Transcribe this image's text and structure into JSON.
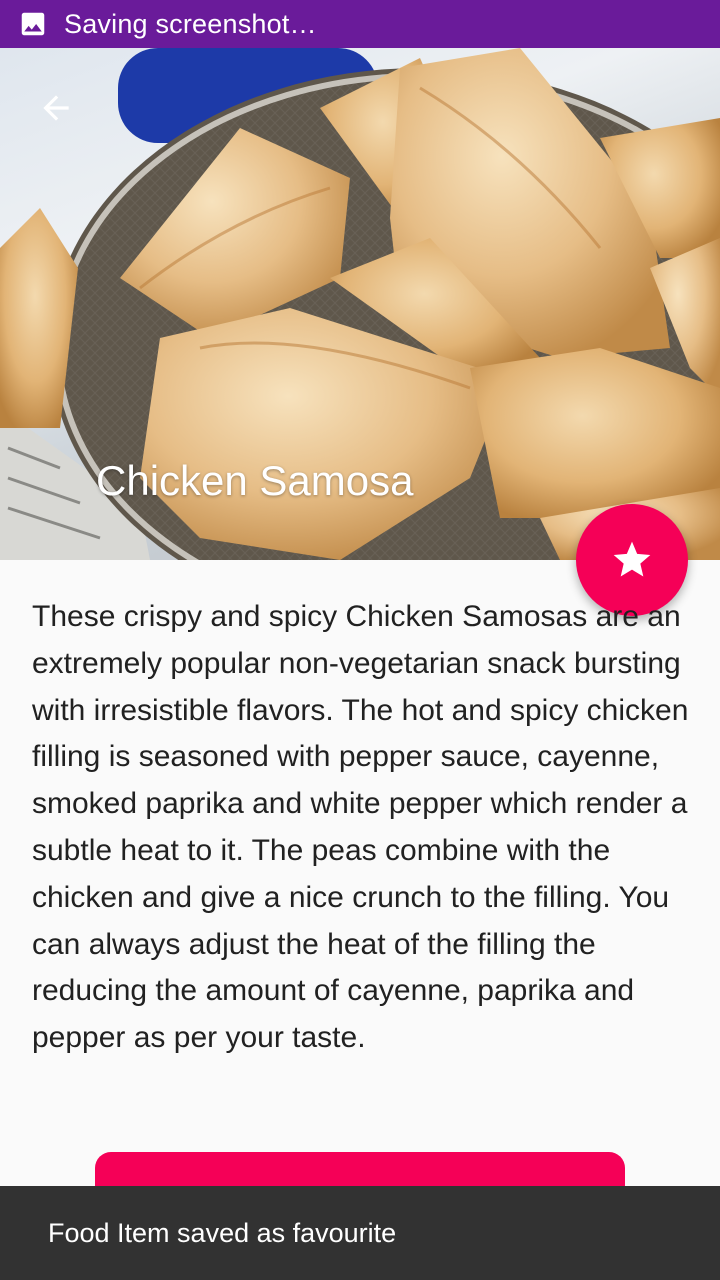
{
  "status_bar": {
    "icon": "image-icon",
    "text": "Saving screenshot…",
    "color": "#6a1b9a"
  },
  "hero": {
    "back_icon": "arrow-back-icon",
    "title": "Chicken Samosa"
  },
  "fab": {
    "icon": "star-icon",
    "color": "#f50057"
  },
  "description": "These crispy and spicy Chicken Samosas are an extremely popular non-vegetarian snack bursting with irresistible flavors. The hot and spicy chicken filling is seasoned with pepper sauce, cayenne, smoked paprika and white pepper which render a subtle heat to it. The peas combine with the chicken and give a nice crunch to the filling. You can always adjust the heat of the filling the reducing the amount of cayenne, paprika and pepper as per your taste.",
  "action_button": {
    "color": "#f50057"
  },
  "snackbar": {
    "message": "Food Item saved as favourite",
    "color": "#323232"
  }
}
